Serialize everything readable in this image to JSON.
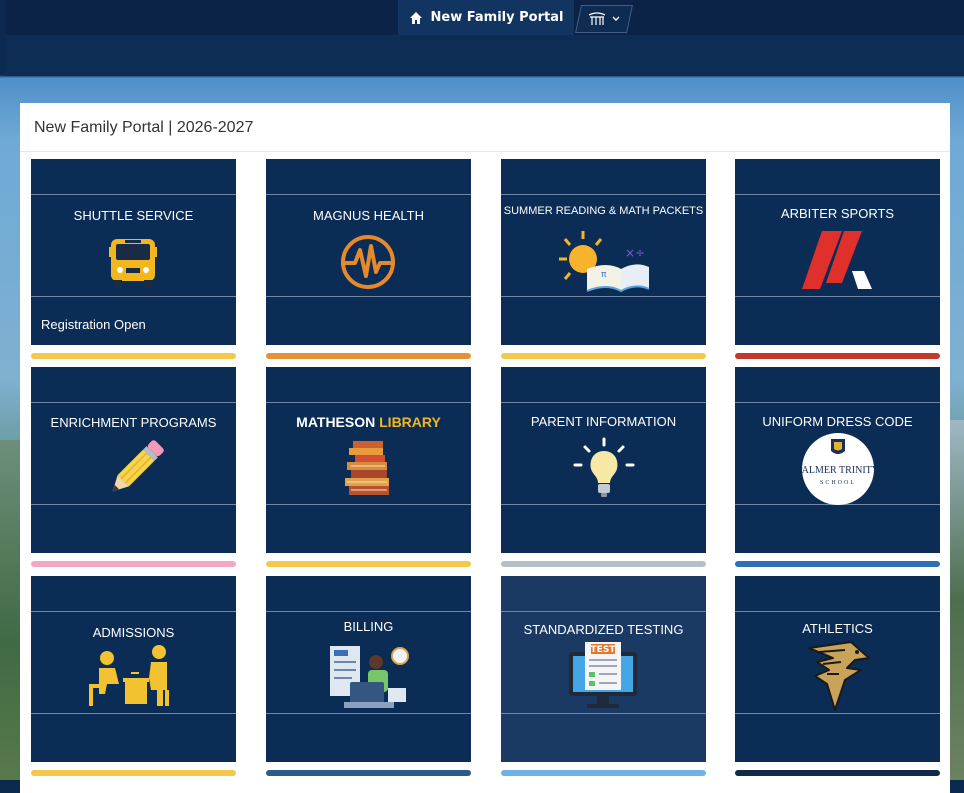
{
  "nav": {
    "title": "New Family Portal"
  },
  "panel": {
    "title": "New Family Portal | 2026-2027"
  },
  "tiles": [
    {
      "title": "SHUTTLE SERVICE",
      "subtitle": "Registration Open",
      "icon": "school-bus-icon",
      "bar_color": "#f2c94c"
    },
    {
      "title": "MAGNUS HEALTH",
      "icon": "heartbeat-icon",
      "bar_color": "#e39234"
    },
    {
      "title": "SUMMER READING & MATH PACKETS",
      "icon": "sun-book-icon",
      "bar_color": "#f2c94c"
    },
    {
      "title": "ARBITER SPORTS",
      "icon": "arbiter-logo-icon",
      "bar_color": "#c0392b"
    },
    {
      "title": "ENRICHMENT PROGRAMS",
      "icon": "pencil-icon",
      "bar_color": "#f4a6c7"
    },
    {
      "title_a": "MATHESON",
      "title_b": "LIBRARY",
      "icon": "book-stack-icon",
      "bar_color": "#f2c94c"
    },
    {
      "title": "PARENT INFORMATION",
      "icon": "lightbulb-icon",
      "bar_color": "#b7bfc6"
    },
    {
      "title": "UNIFORM DRESS CODE",
      "icon": "school-seal-icon",
      "seal_line1": "PALMER TRINITY",
      "seal_line2": "SCHOOL",
      "bar_color": "#2f6fb5"
    },
    {
      "title": "ADMISSIONS",
      "icon": "interview-icon",
      "bar_color": "#f2c94c"
    },
    {
      "title": "BILLING",
      "icon": "billing-icon",
      "bar_color": "#2d5a8c"
    },
    {
      "title": "STANDARDIZED TESTING",
      "icon": "test-monitor-icon",
      "monitor_label": "TEST",
      "bar_color": "#6fb0e8"
    },
    {
      "title": "ATHLETICS",
      "icon": "falcon-icon",
      "bar_color": "#122a4a"
    }
  ],
  "colors": {
    "tile_bg": "#0b2c55",
    "nav_bg": "#0a2347",
    "accent_gold": "#f2c94c"
  }
}
